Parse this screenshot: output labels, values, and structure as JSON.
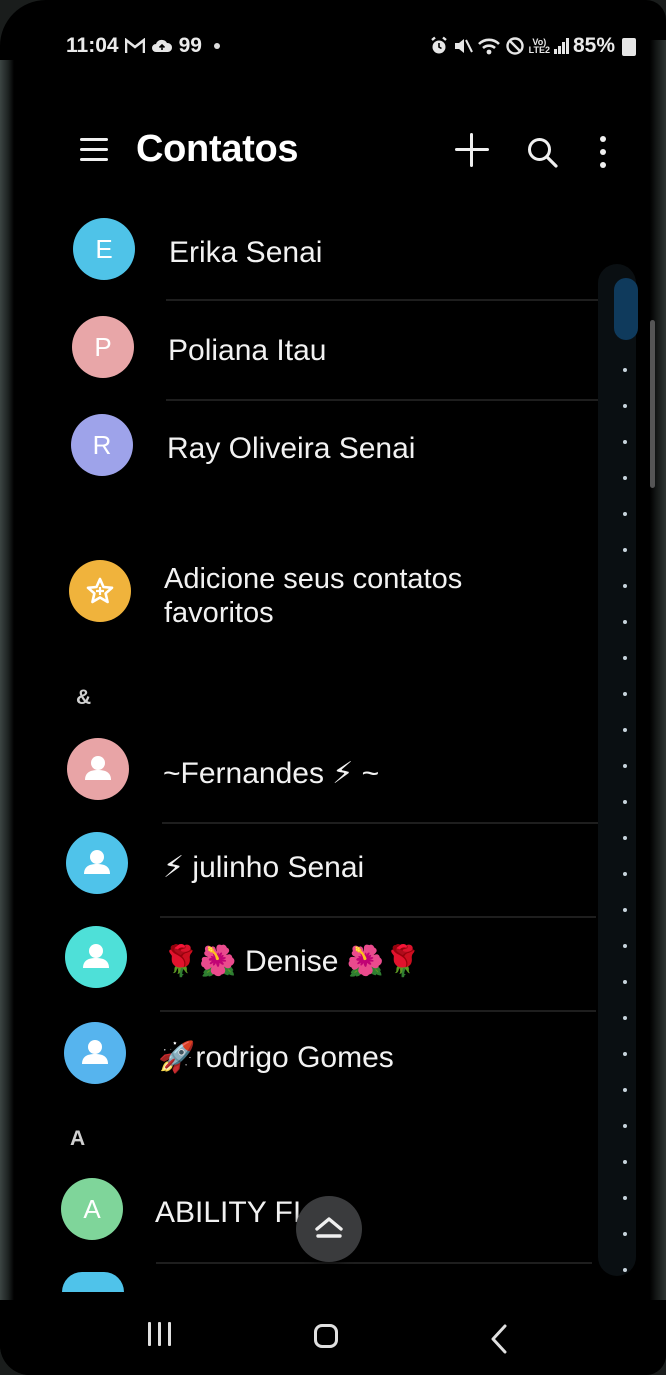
{
  "status_bar": {
    "time": "11:04",
    "left_icons": [
      "gmail-icon",
      "cloud-icon"
    ],
    "notification_count": "99",
    "volte_label_top": "Vo)",
    "volte_label_bottom": "LTE2",
    "battery": "85%"
  },
  "app_bar": {
    "title": "Contatos"
  },
  "contacts_top": [
    {
      "initial": "E",
      "name": "Erika Senai",
      "color": "#4fc3e8"
    },
    {
      "initial": "P",
      "name": "Poliana Itau",
      "color": "#e8a6a8"
    },
    {
      "initial": "R",
      "name": "Ray Oliveira Senai",
      "color": "#9ea3ea"
    }
  ],
  "favorites_prompt": {
    "text": "Adicione seus contatos favoritos",
    "color": "#f0b33c"
  },
  "sections": [
    {
      "letter": "&",
      "contacts": [
        {
          "name": "~Fernandes ⚡ ~",
          "color": "#e8a4a6"
        },
        {
          "name": "⚡ julinho Senai",
          "color": "#4fc3ea"
        },
        {
          "name": "🌹🌺 Denise 🌺🌹",
          "color": "#4ee0d8"
        },
        {
          "name": "🚀rodrigo Gomes",
          "color": "#56b4ee"
        }
      ]
    },
    {
      "letter": "A",
      "contacts": [
        {
          "initial": "A",
          "name": "ABILITY FI",
          "color": "#7fd59a"
        }
      ]
    }
  ],
  "partial_avatar_color": "#4fc3ea"
}
